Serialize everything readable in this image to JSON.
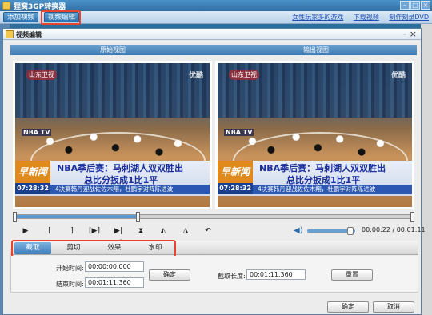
{
  "app": {
    "title": "狸窝3GP转换器",
    "toolbar": {
      "add_video": "添加视频",
      "edit_video": "视频编辑"
    },
    "links": [
      "女性玩家多的游戏",
      "下载视频",
      "制作刻录DVD"
    ]
  },
  "dialog": {
    "title": "视频编辑",
    "original_view": "原始视图",
    "output_view": "输出视图"
  },
  "video": {
    "channel": "山东卫视",
    "watermark": "优酷",
    "news_tag": "早新闻",
    "headline1": "NBA季后赛：马刺湖人双双胜出",
    "headline2": "总比分扳成1比1平",
    "clock": "07:28:32",
    "ticker": "4决赛韩丹迎战佐佐木翔，杜鹏宇对阵陈进波"
  },
  "player": {
    "time": "00:00:22 / 00:01:11",
    "progress": 0.31,
    "volume": 0.9
  },
  "tabs": [
    "截取",
    "剪切",
    "效果",
    "水印"
  ],
  "clip": {
    "start_label": "开始时间:",
    "start_value": "00:00:00.000",
    "end_label": "结束时间:",
    "end_value": "00:01:11.360",
    "confirm": "确定",
    "length_label": "截取长度:",
    "length_value": "00:01:11.360",
    "reset": "重置"
  },
  "footer": {
    "ok": "确定",
    "cancel": "取消"
  }
}
